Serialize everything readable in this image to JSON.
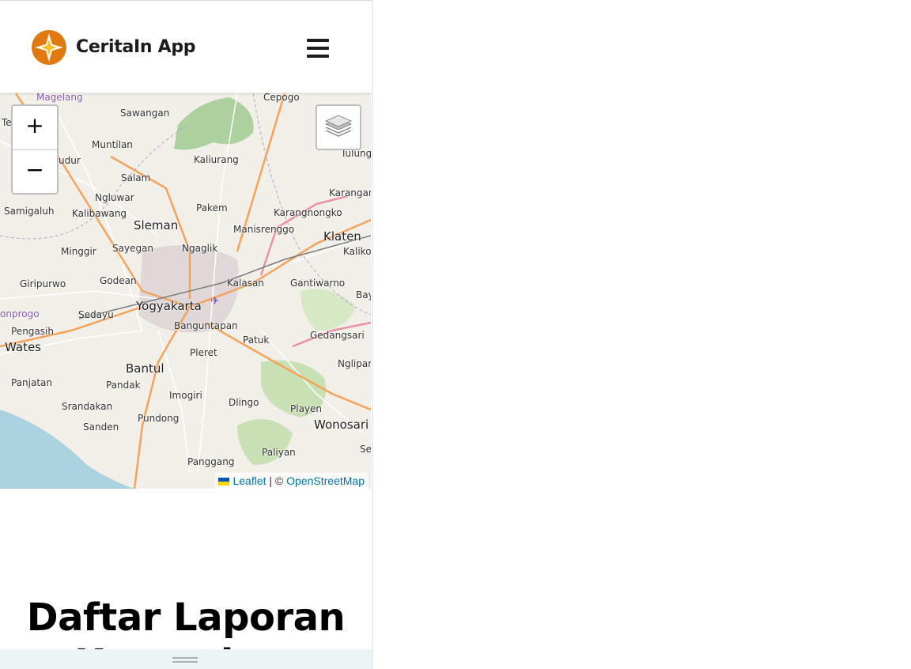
{
  "header": {
    "brand": "CeritaIn App",
    "menu_icon": "hamburger-icon"
  },
  "map": {
    "zoom_in": "+",
    "zoom_out": "−",
    "layers_icon": "layers-icon",
    "attribution": {
      "leaflet": "Leaflet",
      "separator": " | © ",
      "osm": "OpenStreetMap"
    },
    "places": {
      "magelang": "Magelang",
      "cepogo": "Cepogo",
      "sawangan": "Sawangan",
      "muntilan": "Muntilan",
      "tulung": "Tulung",
      "mudur": "udur",
      "kaliurang": "Kaliurang",
      "salam": "Salam",
      "karangan": "Karangan",
      "ngluwar": "Ngluwar",
      "pakem": "Pakem",
      "samigaluh": "Samigaluh",
      "kalibawang": "Kalibawang",
      "karangnongko": "Karangnongko",
      "sleman": "Sleman",
      "manisrenggo": "Manisrenggo",
      "klaten": "Klaten",
      "minggir": "Minggir",
      "sayegan": "Sayegan",
      "ngaglik": "Ngaglik",
      "kaliko": "Kaliko",
      "giripurwo": "Giripurwo",
      "godean": "Godean",
      "kalasan": "Kalasan",
      "gantiwarno": "Gantiwarno",
      "bay": "Bay",
      "yogyakarta": "Yogyakarta",
      "kulonprogo": "onprogo",
      "sedayu": "Sedayu",
      "banguntapan": "Banguntapan",
      "pengasih": "Pengasih",
      "patuk": "Patuk",
      "gedangsari": "Gedangsari",
      "wates": "Wates",
      "pleret": "Pleret",
      "bantul": "Bantul",
      "nglipar": "Nglipar",
      "panjatan": "Panjatan",
      "pandak": "Pandak",
      "imogiri": "Imogiri",
      "srandakan": "Srandakan",
      "dlingo": "Dlingo",
      "playen": "Playen",
      "pundong": "Pundong",
      "wonosari": "Wonosari",
      "sanden": "Sanden",
      "se": "Se",
      "paliyan": "Paliyan",
      "panggang": "Panggang",
      "te": "Te"
    }
  },
  "main": {
    "title": "Daftar Laporan Kerusakan"
  },
  "colors": {
    "map_land": "#f2efe9",
    "sea": "#aad3df",
    "forest": "#add19e",
    "major_road": "#f5a35b",
    "link": "#0078a8",
    "brand_orange": "#e07a10",
    "brand_yellow": "#f7c221"
  }
}
